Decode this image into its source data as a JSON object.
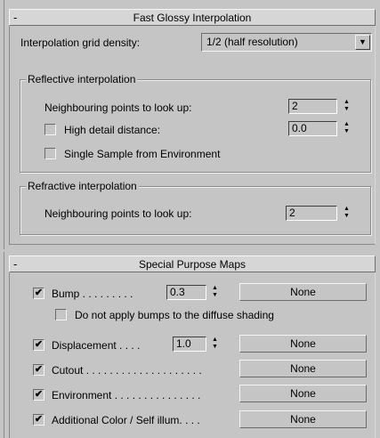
{
  "fast_glossy": {
    "collapse_glyph": "-",
    "title": "Fast Glossy Interpolation",
    "grid_density_label": "Interpolation grid density:",
    "grid_density_value": "1/2 (half resolution)",
    "reflective": {
      "group_label": "Reflective interpolation",
      "neighbouring_label": "Neighbouring points to look up:",
      "neighbouring_value": "2",
      "high_detail_label": "High detail distance:",
      "high_detail_checked": false,
      "high_detail_value": "0.0",
      "single_sample_label": "Single Sample from Environment",
      "single_sample_checked": false
    },
    "refractive": {
      "group_label": "Refractive interpolation",
      "neighbouring_label": "Neighbouring points to look up:",
      "neighbouring_value": "2"
    }
  },
  "special_maps": {
    "collapse_glyph": "-",
    "title": "Special Purpose Maps",
    "bump": {
      "label": "Bump . . . . . . . . .",
      "checked": true,
      "value": "0.3",
      "map": "None"
    },
    "no_diffuse_bump": {
      "label": "Do not apply bumps to the diffuse shading",
      "checked": false
    },
    "displacement": {
      "label": "Displacement . . . .",
      "checked": true,
      "value": "1.0",
      "map": "None"
    },
    "cutout": {
      "label": "Cutout . . . . . . . . . . . . . . . . . . . .",
      "checked": true,
      "map": "None"
    },
    "environment": {
      "label": "Environment . . . . . . . . . . . . . . .",
      "checked": true,
      "map": "None"
    },
    "additional_color": {
      "label": "Additional Color / Self illum. . . .",
      "checked": true,
      "map": "None"
    }
  },
  "glyphs": {
    "check": "✔",
    "spin_up": "▲",
    "spin_down": "▼",
    "combo_arrow": "▼"
  },
  "colors": {
    "panel_bg": "#c5c5c5",
    "header_bg": "#d6d6d6"
  }
}
